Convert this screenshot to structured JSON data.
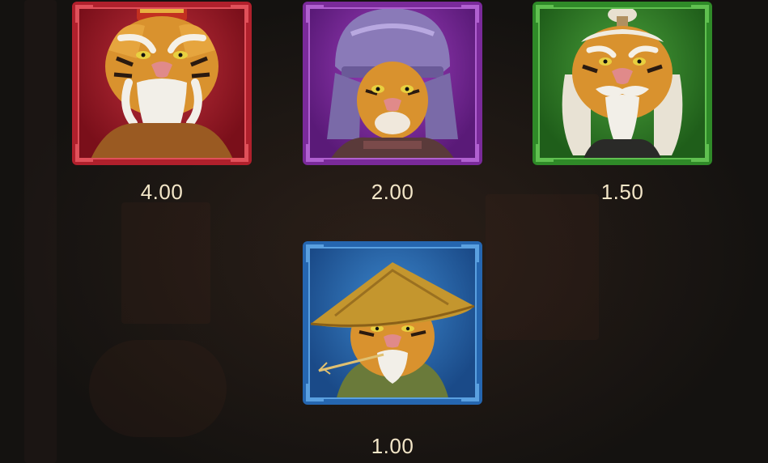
{
  "paytable": {
    "symbols": [
      {
        "id": "red-tiger-elder",
        "payout": "4.00",
        "frame_color": "#b0202c",
        "frame_highlight": "#e0505a",
        "bg_color": "#7a0f1a",
        "bg_highlight": "#c0303c",
        "icon": "tiger-elder-icon"
      },
      {
        "id": "purple-tiger-warrior",
        "payout": "2.00",
        "frame_color": "#7a2a9a",
        "frame_highlight": "#b060d0",
        "bg_color": "#5a1a78",
        "bg_highlight": "#a040c0",
        "icon": "tiger-warrior-helmet-icon"
      },
      {
        "id": "green-tiger-sage",
        "payout": "1.50",
        "frame_color": "#2f8a28",
        "frame_highlight": "#60c050",
        "bg_color": "#1f5e1a",
        "bg_highlight": "#4aa03a",
        "icon": "tiger-sage-icon"
      },
      {
        "id": "blue-tiger-farmer",
        "payout": "1.00",
        "frame_color": "#2566b0",
        "frame_highlight": "#5aa0e0",
        "bg_color": "#1a4a88",
        "bg_highlight": "#3c86cc",
        "icon": "tiger-straw-hat-icon"
      }
    ]
  }
}
